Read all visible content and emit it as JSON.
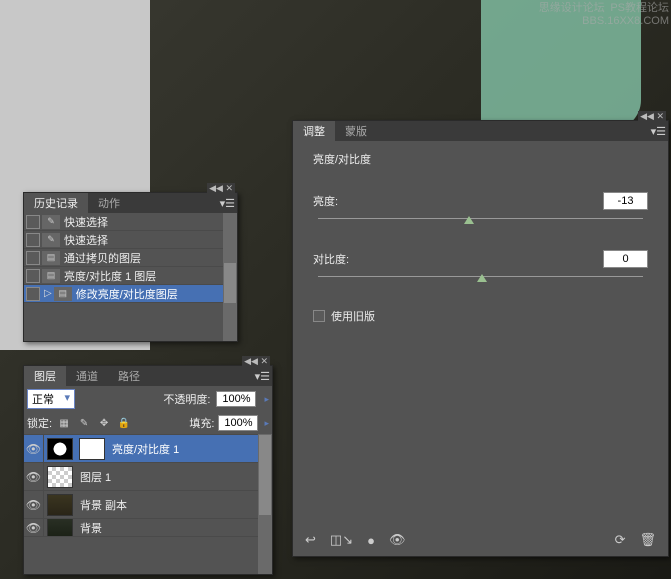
{
  "watermark": {
    "line1": "思缘设计论坛",
    "line2": "PS教程论坛",
    "line3": "BBS.16XX8.COM"
  },
  "history": {
    "tab1": "历史记录",
    "tab2": "动作",
    "items": [
      {
        "label": "快速选择",
        "icon": "brush"
      },
      {
        "label": "快速选择",
        "icon": "brush"
      },
      {
        "label": "通过拷贝的图层",
        "icon": "layer"
      },
      {
        "label": "亮度/对比度 1 图层",
        "icon": "layer"
      },
      {
        "label": "修改亮度/对比度图层",
        "icon": "layer",
        "active": true
      }
    ]
  },
  "layers": {
    "tab1": "图层",
    "tab2": "通道",
    "tab3": "路径",
    "blend_mode": "正常",
    "opacity_label": "不透明度:",
    "opacity_value": "100%",
    "lock_label": "锁定:",
    "fill_label": "填充:",
    "fill_value": "100%",
    "items": [
      {
        "name": "亮度/对比度 1",
        "active": true,
        "type": "adjustment"
      },
      {
        "name": "图层 1",
        "type": "checker"
      },
      {
        "name": "背景 副本",
        "type": "img1"
      },
      {
        "name": "背景",
        "type": "img2"
      }
    ]
  },
  "adjust": {
    "tab1": "调整",
    "tab2": "蒙版",
    "heading": "亮度/对比度",
    "brightness_label": "亮度:",
    "brightness_value": "-13",
    "contrast_label": "对比度:",
    "contrast_value": "0",
    "legacy_label": "使用旧版"
  }
}
